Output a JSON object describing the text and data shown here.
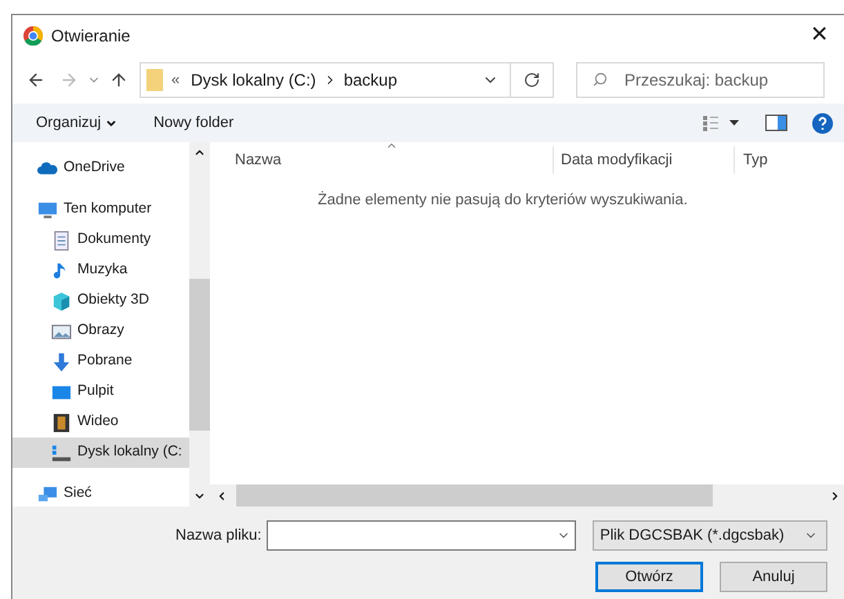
{
  "window": {
    "title": "Otwieranie",
    "close": "✕"
  },
  "address": {
    "overflow": "«",
    "path": [
      {
        "label": "Dysk lokalny (C:)"
      },
      {
        "label": "backup"
      }
    ]
  },
  "search": {
    "placeholder": "Przeszukaj: backup"
  },
  "toolbar": {
    "organize": "Organizuj",
    "new_folder": "Nowy folder"
  },
  "sidebar": {
    "items": [
      {
        "label": "OneDrive",
        "kind": "cloud",
        "selected": false
      },
      {
        "label": "Ten komputer",
        "kind": "computer",
        "selected": false,
        "children": [
          {
            "label": "Dokumenty",
            "kind": "document",
            "selected": false
          },
          {
            "label": "Muzyka",
            "kind": "music",
            "selected": false
          },
          {
            "label": "Obiekty 3D",
            "kind": "cube",
            "selected": false
          },
          {
            "label": "Obrazy",
            "kind": "image",
            "selected": false
          },
          {
            "label": "Pobrane",
            "kind": "download",
            "selected": false
          },
          {
            "label": "Pulpit",
            "kind": "desktop",
            "selected": false
          },
          {
            "label": "Wideo",
            "kind": "film",
            "selected": false
          },
          {
            "label": "Dysk lokalny (C:",
            "kind": "drive",
            "selected": true
          }
        ]
      },
      {
        "label": "Sieć",
        "kind": "network",
        "selected": false
      }
    ]
  },
  "table": {
    "columns": [
      "Nazwa",
      "Data modyfikacji",
      "Typ"
    ],
    "empty_message": "Żadne elementy nie pasują do kryteriów wyszukiwania."
  },
  "footer": {
    "file_name_label": "Nazwa pliku:",
    "file_type": "Plik DGCSBAK (*.dgcsbak)",
    "buttons": [
      {
        "label": "Otwórz",
        "kind": "primary"
      },
      {
        "label": "Anuluj",
        "kind": "normal"
      }
    ]
  }
}
